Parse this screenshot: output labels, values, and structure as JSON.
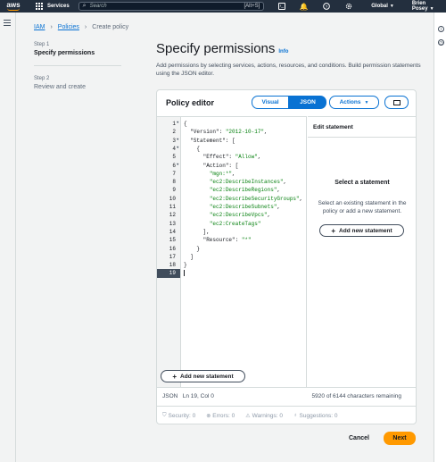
{
  "topnav": {
    "logo_text": "aws",
    "services_label": "Services",
    "search_placeholder": "Search",
    "search_shortcut": "[Alt+S]",
    "region_label": "Global",
    "user_label": "Brien Posey"
  },
  "breadcrumb": {
    "items": [
      "IAM",
      "Policies"
    ],
    "current": "Create policy"
  },
  "steps": [
    {
      "number": "Step 1",
      "title": "Specify permissions",
      "active": true
    },
    {
      "number": "Step 2",
      "title": "Review and create",
      "active": false
    }
  ],
  "page": {
    "title": "Specify permissions",
    "info_label": "Info",
    "description": "Add permissions by selecting services, actions, resources, and conditions. Build permission statements using the JSON editor."
  },
  "editor": {
    "title": "Policy editor",
    "mode_visual": "Visual",
    "mode_json": "JSON",
    "selected_mode": "JSON",
    "actions_label": "Actions",
    "lines": [
      {
        "n": "1",
        "fold": true,
        "text": "{"
      },
      {
        "n": "2",
        "fold": false,
        "text": "  \"Version\": \"2012-10-17\","
      },
      {
        "n": "3",
        "fold": true,
        "text": "  \"Statement\": ["
      },
      {
        "n": "4",
        "fold": true,
        "text": "    {"
      },
      {
        "n": "5",
        "fold": false,
        "text": "      \"Effect\": \"Allow\","
      },
      {
        "n": "6",
        "fold": true,
        "text": "      \"Action\": ["
      },
      {
        "n": "7",
        "fold": false,
        "text": "        \"mgn:*\","
      },
      {
        "n": "8",
        "fold": false,
        "text": "        \"ec2:DescribeInstances\","
      },
      {
        "n": "9",
        "fold": false,
        "text": "        \"ec2:DescribeRegions\","
      },
      {
        "n": "10",
        "fold": false,
        "text": "        \"ec2:DescribeSecurityGroups\","
      },
      {
        "n": "11",
        "fold": false,
        "text": "        \"ec2:DescribeSubnets\","
      },
      {
        "n": "12",
        "fold": false,
        "text": "        \"ec2:DescribeVpcs\","
      },
      {
        "n": "13",
        "fold": false,
        "text": "        \"ec2:CreateTags\""
      },
      {
        "n": "14",
        "fold": false,
        "text": "      ],"
      },
      {
        "n": "15",
        "fold": false,
        "text": "      \"Resource\": \"*\""
      },
      {
        "n": "16",
        "fold": false,
        "text": "    }"
      },
      {
        "n": "17",
        "fold": false,
        "text": "  ]"
      },
      {
        "n": "18",
        "fold": false,
        "text": "}"
      },
      {
        "n": "19",
        "fold": false,
        "text": ""
      }
    ],
    "current_line": "19",
    "add_statement_label": "Add new statement",
    "edit_statement_title": "Edit statement",
    "select_statement_title": "Select a statement",
    "select_statement_desc": "Select an existing statement in the policy or add a new statement.",
    "status_mode": "JSON",
    "status_position": "Ln 19, Col 0",
    "chars_remaining": "5920 of 6144 characters remaining",
    "validation": {
      "security": "Security: 0",
      "errors": "Errors: 0",
      "warnings": "Warnings: 0",
      "suggestions": "Suggestions: 0"
    }
  },
  "footer": {
    "cancel_label": "Cancel",
    "next_label": "Next"
  },
  "colors": {
    "nav_bg": "#232f3e",
    "link": "#0972d3",
    "primary_button": "#ff9900",
    "json_string": "#037f0c"
  }
}
